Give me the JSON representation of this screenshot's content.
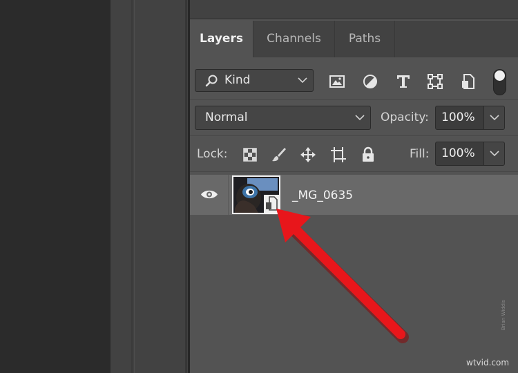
{
  "layers_panel": {
    "tabs": [
      {
        "label": "Layers",
        "active": true
      },
      {
        "label": "Channels",
        "active": false
      },
      {
        "label": "Paths",
        "active": false
      }
    ],
    "filter": {
      "kind_label": "Kind",
      "icons": [
        "pixel-layer-filter-icon",
        "adjustment-layer-filter-icon",
        "type-layer-filter-icon",
        "shape-layer-filter-icon",
        "smart-object-filter-icon",
        "filter-toggle-icon"
      ]
    },
    "blend_mode": "Normal",
    "opacity_label": "Opacity:",
    "opacity_value": "100%",
    "lock_label": "Lock:",
    "lock_icons": [
      "lock-transparent-pixels-icon",
      "lock-image-pixels-icon",
      "lock-position-icon",
      "lock-artboard-icon",
      "lock-all-icon"
    ],
    "fill_label": "Fill:",
    "fill_value": "100%",
    "layers": [
      {
        "name": "_MG_0635",
        "visible": true,
        "smart_object": true
      }
    ]
  },
  "annotation": {
    "color": "#e8161b"
  },
  "watermark": "wtvid.com",
  "credit": "Brian Widdis"
}
